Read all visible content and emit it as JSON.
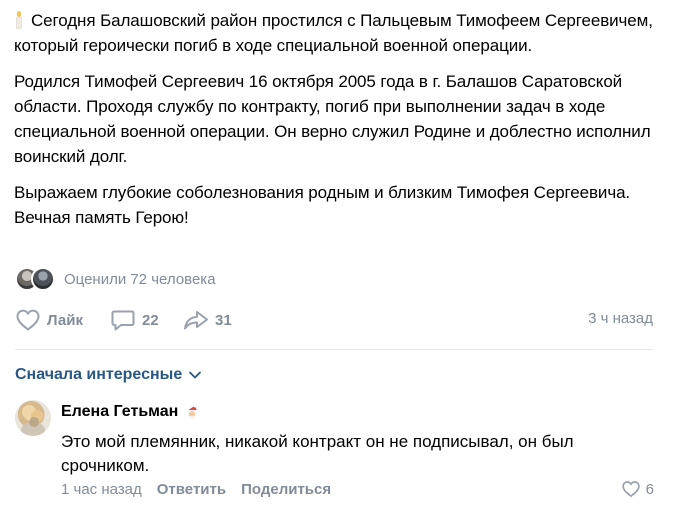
{
  "post": {
    "paragraphs": [
      "Сегодня Балашовский район простился с Пальцевым Тимофеем Сергеевичем, который героически погиб в ходе специальной военной операции.",
      "Родился Тимофей Сергеевич 16 октября 2005 года в г. Балашов Саратовской области. Проходя службу по контракту, погиб при выполнении задач в ходе специальной военной операции. Он верно служил Родине и доблестно исполнил воинский долг.",
      "Выражаем глубокие соболезнования родным и близким Тимофея Сергеевича. Вечная память Герою!"
    ],
    "lead_icon": "candle-icon",
    "reactions_text": "Оценили 72 человека",
    "like_label": "Лайк",
    "comments_count": "22",
    "shares_count": "31",
    "time": "3 ч назад"
  },
  "comments": {
    "sort_label": "Сначала интересные",
    "items": [
      {
        "author": "Елена Гетьман",
        "badge_icon": "santa-emoji-icon",
        "text": "Это мой племянник, никакой контракт он не подписывал, он был срочником.",
        "time": "1 час назад",
        "reply_label": "Ответить",
        "share_label": "Поделиться",
        "likes": "6"
      }
    ]
  },
  "colors": {
    "muted": "#818c99",
    "link": "#2a5885",
    "divider": "#e7e8ec"
  }
}
